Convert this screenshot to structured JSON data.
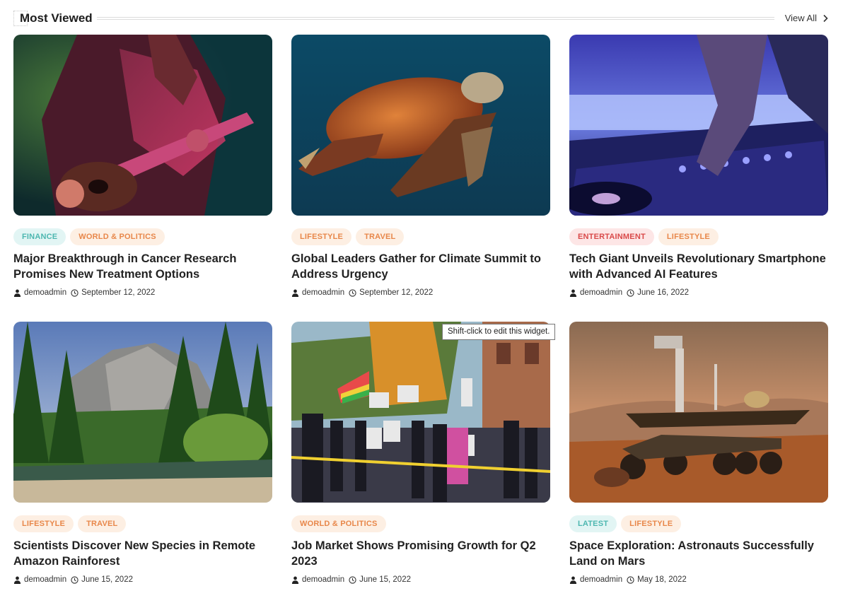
{
  "section": {
    "title": "Most Viewed",
    "view_all": "View All"
  },
  "icons": {
    "author": "user-icon",
    "date": "clock-icon",
    "view_all": "chevron-right-icon"
  },
  "colors": {
    "teal": "#4db7b0",
    "orange": "#e8874a",
    "red": "#d94a4a"
  },
  "posts": [
    {
      "categories": [
        "FINANCE",
        "WORLD & POLITICS"
      ],
      "title": "Major Breakthrough in Cancer Research Promises New Treatment Options",
      "author": "demoadmin",
      "date": "September 12, 2022",
      "image": "guitarist-photo"
    },
    {
      "categories": [
        "LIFESTYLE",
        "TRAVEL"
      ],
      "title": "Global Leaders Gather for Climate Summit to Address Urgency",
      "author": "demoadmin",
      "date": "September 12, 2022",
      "image": "sea-turtle-photo"
    },
    {
      "categories": [
        "ENTERTAINMENT",
        "LIFESTYLE"
      ],
      "title": "Tech Giant Unveils Revolutionary Smartphone with Advanced AI Features",
      "author": "demoadmin",
      "date": "June 16, 2022",
      "image": "dj-mixer-photo"
    },
    {
      "categories": [
        "LIFESTYLE",
        "TRAVEL"
      ],
      "title": "Scientists Discover New Species in Remote Amazon Rainforest",
      "author": "demoadmin",
      "date": "June 15, 2022",
      "image": "valley-forest-photo"
    },
    {
      "categories": [
        "WORLD & POLITICS"
      ],
      "title": "Job Market Shows Promising Growth for Q2 2023",
      "author": "demoadmin",
      "date": "June 15, 2022",
      "image": "street-protest-photo"
    },
    {
      "categories": [
        "LATEST",
        "LIFESTYLE"
      ],
      "title": "Space Exploration: Astronauts Successfully Land on Mars",
      "author": "demoadmin",
      "date": "May 18, 2022",
      "image": "mars-rover-photo"
    }
  ],
  "tooltip": "Shift-click to edit this widget."
}
